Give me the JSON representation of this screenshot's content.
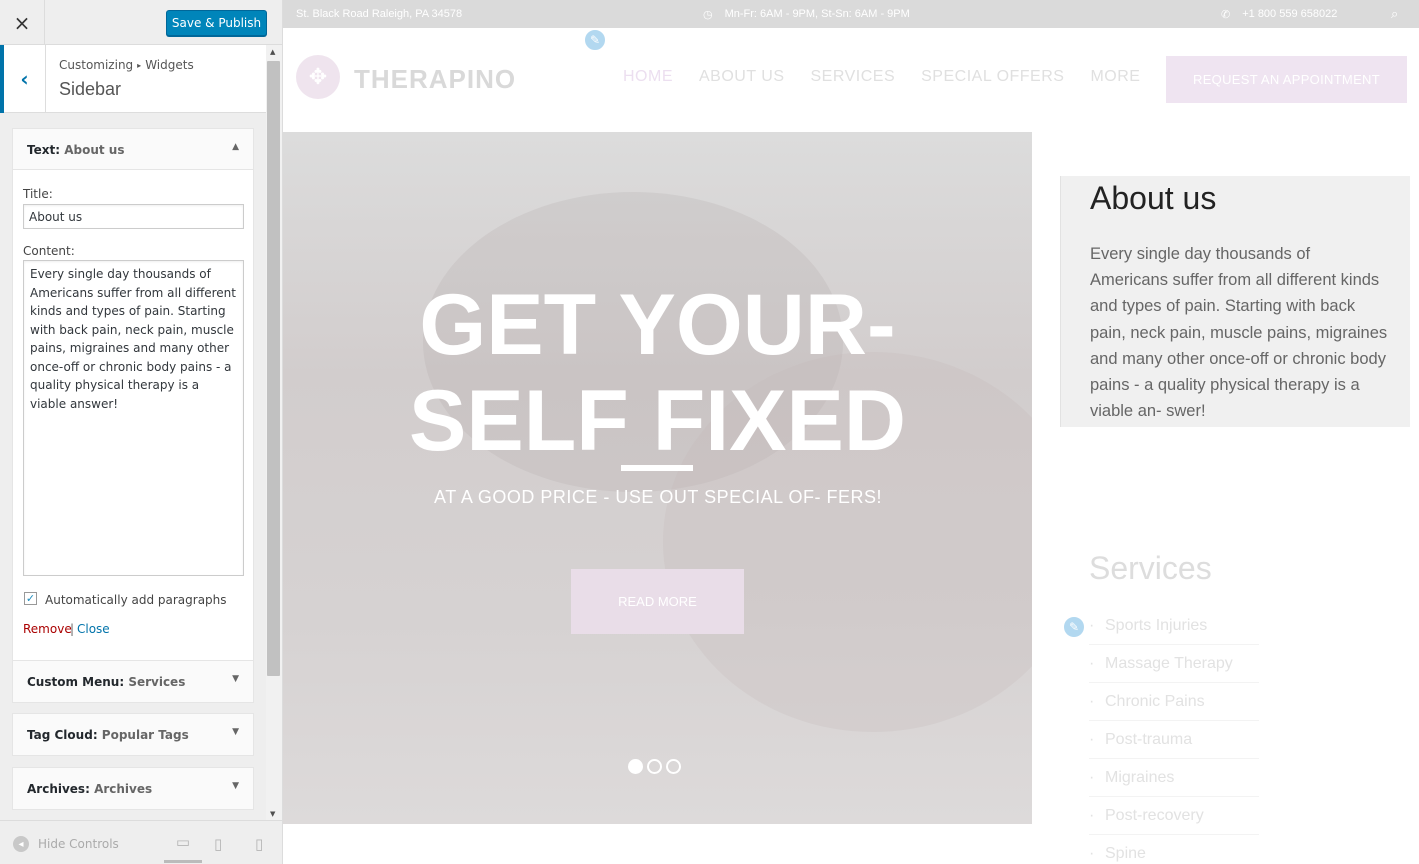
{
  "customizer": {
    "close_icon": "×",
    "publish_label": "Save & Publish",
    "breadcrumb": {
      "root": "Customizing",
      "separator": "▸",
      "current": "Widgets"
    },
    "section_name": "Sidebar",
    "back_icon": "‹",
    "widgets": [
      {
        "type": "Text",
        "name": "About us",
        "arrow": "▲"
      },
      {
        "type": "Custom Menu",
        "name": "Services",
        "arrow": "▼"
      },
      {
        "type": "Tag Cloud",
        "name": "Popular Tags",
        "arrow": "▼"
      },
      {
        "type": "Archives",
        "name": "Archives",
        "arrow": "▼"
      }
    ],
    "form": {
      "title_label": "Title:",
      "title_value": "About us",
      "content_label": "Content:",
      "content_value": "Every single day thousands of Americans suffer from all different kinds and types of pain. Starting with back pain, neck pain, muscle pains, migraines and many other once-off or chronic body pains - a quality physical therapy is a viable answer!",
      "autop_checked": "✓",
      "autop_label": "Automatically add paragraphs",
      "remove_label": "Remove",
      "link_separator": "|",
      "close_label": "Close"
    },
    "footer": {
      "hide_controls_label": "Hide Controls",
      "hide_icon": "◂",
      "desktop_icon": "▭",
      "tablet_icon": "▯",
      "mobile_icon": "▯"
    }
  },
  "site": {
    "topbar": {
      "address": "St. Black Road Raleigh, PA 34578",
      "clock_icon": "◷",
      "hours": "Mn-Fr: 6AM - 9PM, St-Sn: 6AM - 9PM",
      "phone_icon": "✆",
      "phone": "+1 800 559 658022",
      "search_icon": "⌕"
    },
    "logo_icon": "✥",
    "logo_text": "THERAPINO",
    "edit_icon": "✎",
    "nav": [
      "HOME",
      "ABOUT US",
      "SERVICES",
      "SPECIAL OFFERS",
      "MORE"
    ],
    "cta_label": "REQUEST AN APPOINTMENT",
    "hero": {
      "headline_line1": "GET YOUR-",
      "headline_line2": "SELF FIXED",
      "subtitle": "AT A GOOD PRICE - USE OUT SPECIAL OF- FERS!",
      "button_label": "READ MORE",
      "active_slide": 1,
      "slide_count": 3
    },
    "sidebar": {
      "about_title": "About us",
      "about_text": "Every single day thousands of Americans suffer from all different kinds and types of pain. Starting with back pain, neck pain, muscle pains, migraines and many other once-off or chronic body pains - a quality physical therapy is a viable an- swer!",
      "services_title": "Services",
      "services": [
        "Sports Injuries",
        "Massage Therapy",
        "Chronic Pains",
        "Post-trauma",
        "Migraines",
        "Post-recovery",
        "Spine"
      ]
    }
  }
}
